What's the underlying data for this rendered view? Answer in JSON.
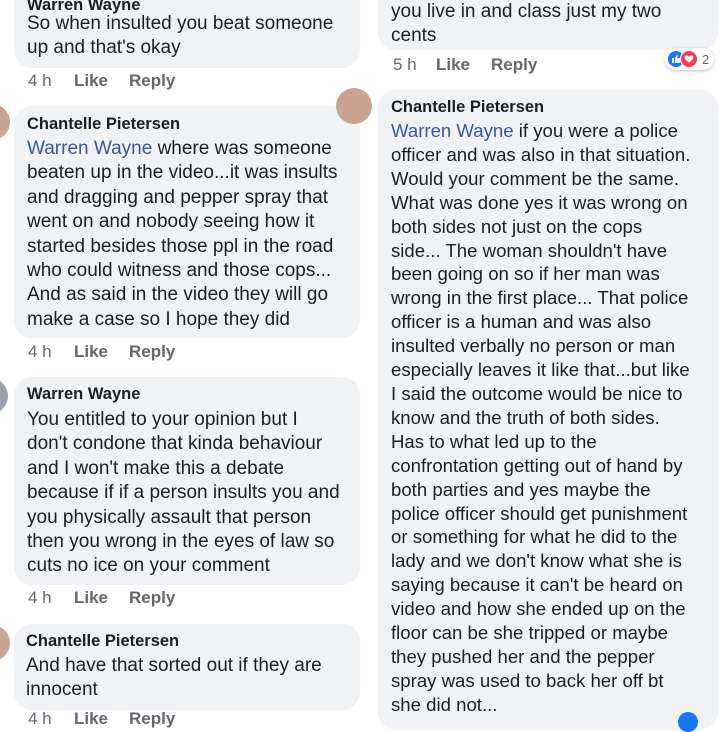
{
  "left_column": {
    "comment_1": {
      "author": "Warren Wayne",
      "lines": [
        "So when insulted you beat someone",
        "up and that's okay"
      ],
      "time": "4 h",
      "like": "Like",
      "reply": "Reply"
    },
    "comment_2": {
      "author": "Chantelle Pietersen",
      "mention": "Warren Wayne",
      "first_line_rest": " where was someone",
      "lines": [
        "beaten up in the video...it was insults",
        "and dragging and pepper spray that",
        "went on and nobody seeing how it",
        "started besides those ppl in the road",
        "who could witness and those cops...",
        "And as said in the video they will go",
        "make a case so I hope they did"
      ],
      "time": "4 h",
      "like": "Like",
      "reply": "Reply"
    },
    "comment_3": {
      "author": "Warren Wayne",
      "lines": [
        "You entitled to your opinion but I",
        "don't condone that kinda behaviour",
        "and I won't make this a debate",
        "because if if a person insults you and",
        "you physically assault that person",
        "then you wrong in the eyes of law so",
        "cuts no ice on your comment"
      ],
      "time": "4 h",
      "like": "Like",
      "reply": "Reply"
    },
    "comment_4": {
      "author": "Chantelle Pietersen",
      "lines": [
        "And have that sorted out if they are",
        "innocent"
      ],
      "time": "4 h",
      "like": "Like",
      "reply": "Reply"
    }
  },
  "right_column": {
    "comment_1": {
      "lines": [
        "you live in and class just my two",
        "cents"
      ],
      "time": "5 h",
      "like": "Like",
      "reply": "Reply",
      "reaction_count": "2"
    },
    "comment_2": {
      "author": "Chantelle Pietersen",
      "mention": "Warren Wayne",
      "first_line_rest": " if you were a police",
      "lines": [
        "officer and was also in that situation.",
        "Would your comment be the same.",
        "What was done yes it was wrong on",
        "both sides not just on the cops",
        "side... The woman shouldn't have",
        "been going on so if her man was",
        "wrong in the first place... That police",
        "officer is a human and was also",
        "insulted verbally no person or man",
        "especially leaves it like that...but like",
        "I said the outcome would be nice to",
        "know and the truth of both sides.",
        "Has to what led up to the",
        "confrontation getting out of hand by",
        "both parties and yes maybe the",
        "police officer should get punishment",
        "or something for what he did to the",
        "lady and we don't know what she is",
        "saying because it can't be heard on",
        "video and how she ended up on the",
        "floor can be she tripped or maybe",
        "they pushed her and the pepper",
        "spray was used to back her off bt",
        "she did not..."
      ]
    }
  },
  "colors": {
    "bubble": "#f0f2f5",
    "mention": "#385898",
    "meta": "#65676b",
    "like_reaction": "#1877f2",
    "love_reaction": "#f33e58"
  },
  "icons": {
    "like_reaction": "thumbs-up-icon",
    "love_reaction": "heart-icon"
  }
}
